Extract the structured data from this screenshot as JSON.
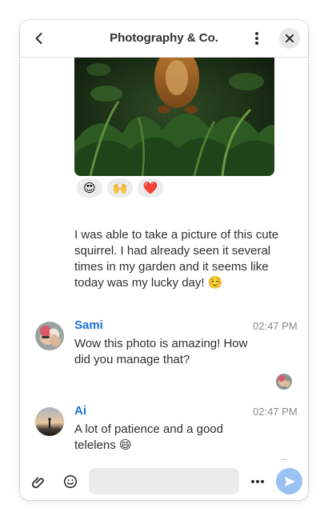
{
  "header": {
    "title": "Photography & Co.",
    "back_icon": "go-back-icon",
    "menu_icon": "kebab-menu-icon",
    "close_icon": "close-icon"
  },
  "photo_message": {
    "reactions": [
      {
        "emoji": "😍"
      },
      {
        "emoji": "🙌"
      },
      {
        "emoji": "❤️"
      }
    ],
    "text": "I was able to take a picture of this cute squirrel. I had already seen it several times in my garden and it seems like today was my lucky day! ☺️"
  },
  "messages": [
    {
      "sender": "Sami",
      "time": "02:47 PM",
      "text": "Wow this photo is amazing! How did you manage that?"
    },
    {
      "sender": "Ai",
      "time": "02:47 PM",
      "text": "A lot of patience and a good telelens 😄"
    }
  ],
  "composer": {
    "placeholder": "",
    "attach_icon": "paperclip-icon",
    "emoji_icon": "emoji-icon",
    "more_icon": "more-options-icon",
    "send_icon": "send-icon"
  },
  "colors": {
    "accent": "#1c71d8",
    "send_button": "#99c1f1",
    "input_bg": "#ebebeb",
    "reaction_bg": "#ececec"
  }
}
